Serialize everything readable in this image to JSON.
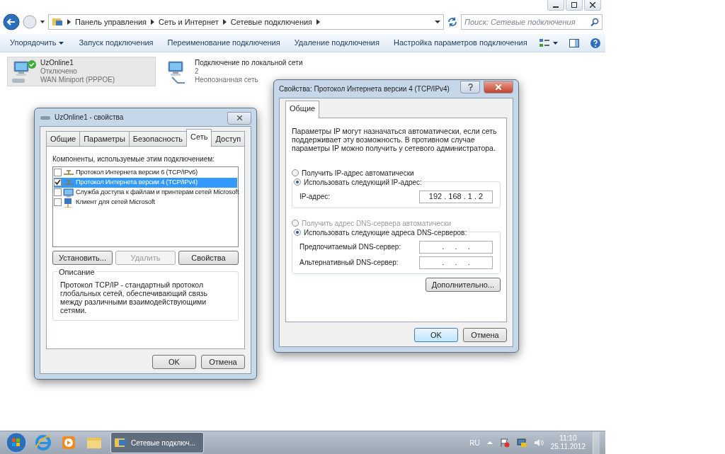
{
  "explorer": {
    "breadcrumb": [
      "Панель управления",
      "Сеть и Интернет",
      "Сетевые подключения"
    ],
    "search": {
      "placeholder": "Поиск: Сетевые подключения"
    },
    "toolbar": [
      "Упорядочить",
      "Запуск подключения",
      "Переименование подключения",
      "Удаление подключения",
      "Настройка параметров подключения"
    ],
    "connections": [
      {
        "name": "UzOnline1",
        "status": "Отключено",
        "device": "WAN Miniport (PPPOE)",
        "selected": true
      },
      {
        "name": "Подключение по локальной сети",
        "status": "2",
        "device": "Неопознанная сеть",
        "selected": false
      }
    ]
  },
  "properties_dialog": {
    "title": "UzOnline1 - свойства",
    "tabs": [
      {
        "label": "Общие",
        "selected": false
      },
      {
        "label": "Параметры",
        "selected": false
      },
      {
        "label": "Безопасность",
        "selected": false
      },
      {
        "label": "Сеть",
        "selected": true
      },
      {
        "label": "Доступ",
        "selected": false
      }
    ],
    "components_label": "Компоненты, используемые этим подключением:",
    "components": [
      {
        "label": "Протокол Интернета версии 6 (TCP/IPv6)",
        "checked": false,
        "selected": false
      },
      {
        "label": "Протокол Интернета версии 4 (TCP/IPv4)",
        "checked": true,
        "selected": true
      },
      {
        "label": "Служба доступа к файлам и принтерам сетей Microsoft",
        "checked": false,
        "selected": false
      },
      {
        "label": "Клиент для сетей Microsoft",
        "checked": false,
        "selected": false
      }
    ],
    "buttons": [
      {
        "label": "Установить...",
        "disabled": false
      },
      {
        "label": "Удалить",
        "disabled": true
      },
      {
        "label": "Свойства",
        "disabled": false
      }
    ],
    "description_title": "Описание",
    "description": "Протокол TCP/IP - стандартный протокол глобальных сетей, обеспечивающий связь между различными взаимодействующими сетями.",
    "footer": [
      {
        "label": "OK",
        "default": false
      },
      {
        "label": "Отмена",
        "default": false
      }
    ]
  },
  "ipv4_dialog": {
    "title": "Свойства: Протокол Интернета версии 4 (TCP/IPv4)",
    "tabs": [
      {
        "label": "Общие",
        "selected": true
      }
    ],
    "intro": "Параметры IP могут назначаться автоматически, если сеть поддерживает эту возможность. В противном случае параметры IP можно получить у сетевого администратора.",
    "ip_options": [
      {
        "label": "Получить IP-адрес автоматически",
        "selected": false,
        "disabled": false
      },
      {
        "label": "Использовать следующий IP-адрес:",
        "selected": true,
        "disabled": false
      }
    ],
    "ip_fields": [
      {
        "label": "IP-адрес:",
        "value": "192 . 168 . 1 . 2"
      }
    ],
    "dns_options": [
      {
        "label": "Получить адрес DNS-сервера автоматически",
        "selected": false,
        "disabled": true
      },
      {
        "label": "Использовать следующие адреса DNS-серверов:",
        "selected": true,
        "disabled": false
      }
    ],
    "dns_fields": [
      {
        "label": "Предпочитаемый DNS-сервер:",
        "value": ".     .     ."
      },
      {
        "label": "Альтернативный DNS-сервер:",
        "value": ".     .     ."
      }
    ],
    "advanced_button": "Дополнительно...",
    "footer": [
      {
        "label": "OK",
        "default": true
      },
      {
        "label": "Отмена",
        "default": false
      }
    ]
  },
  "taskbar": {
    "task": "Сетевые подключ...",
    "language": "RU",
    "time": "11:10",
    "date": "25.11.2012"
  }
}
